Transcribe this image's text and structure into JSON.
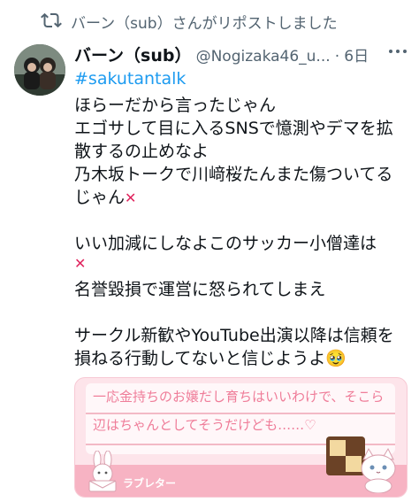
{
  "repost": {
    "text": "バーン（sub）さんがリポストしました",
    "icon": "repost-icon"
  },
  "tweet": {
    "display_name": "バーン（sub）",
    "handle": "@Nogizaka46_u...",
    "dot": "·",
    "time": "6日",
    "hashtag": "#sakutantalk",
    "lines": [
      "ほらーだから言ったじゃん",
      "エゴサして目に入るSNSで憶測やデマを拡",
      "散するの止めなよ",
      "乃木坂トークで川﨑桜たんまた傷ついてる",
      "じゃん",
      "いい加減にしなよこのサッカー小僧達は",
      "名誉毀損で運営に怒られてしまえ",
      "サークル新歓やYouTube出演以降は信頼を",
      "損ねる行動してないと信じようよ🥹"
    ],
    "cross_mark": "✕"
  },
  "card": {
    "lines": [
      "一応金持ちのお嬢だし育ちはいいわけで、そこら",
      "辺はちゃんとしてそうだけども……♡"
    ],
    "footer_label": "ラブレター",
    "colors": {
      "bg": "#fde4ea",
      "text": "#ef7d99"
    }
  },
  "colors": {
    "link": "#1d9bf0",
    "muted": "#536471",
    "text": "#0f1419"
  }
}
